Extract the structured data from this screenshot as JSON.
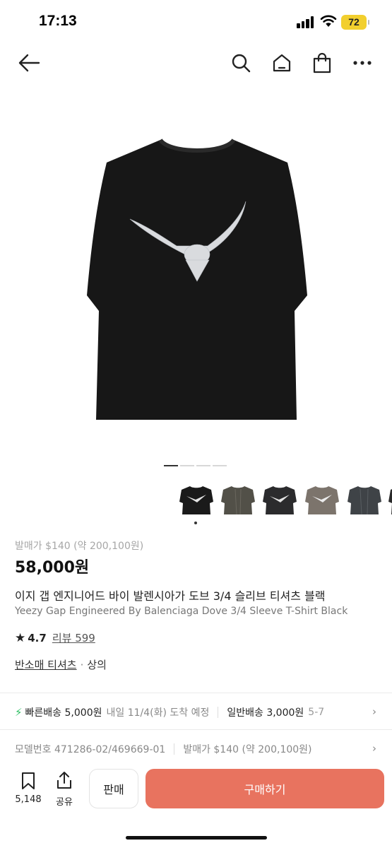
{
  "status_bar": {
    "time": "17:13",
    "battery": "72"
  },
  "nav": {
    "icons": [
      "back-arrow-icon",
      "search-icon",
      "home-icon",
      "shopping-bag-icon",
      "more-icon"
    ]
  },
  "gallery": {
    "thumbnail_count": 6,
    "active_index": 0
  },
  "product": {
    "release_price": "발매가 $140 (약 200,100원)",
    "price": "58,000원",
    "name_ko": "이지 갭 엔지니어드 바이 발렌시아가 도브 3/4 슬리브 티셔츠 블랙",
    "name_en": "Yeezy Gap Engineered By Balenciaga Dove 3/4 Sleeve T-Shirt Black",
    "rating": "4.7",
    "review_label": "리뷰 599",
    "category_primary": "반소매 티셔츠",
    "category_separator": "·",
    "category_secondary": "상의"
  },
  "delivery": {
    "fast_label": "빠른배송 5,000원",
    "fast_eta": "내일 11/4(화) 도착 예정",
    "normal_label": "일반배송 3,000원",
    "normal_eta": "5-7"
  },
  "model_row": {
    "model_number": "모델번호 471286-02/469669-01",
    "release_price": "발매가 $140 (약 200,100원)"
  },
  "bottom_bar": {
    "bookmark_count": "5,148",
    "share_label": "공유",
    "sell_label": "판매",
    "buy_label": "구매하기"
  },
  "colors": {
    "buy_button": "#e8735f",
    "fast_delivery_icon": "#2dbf63",
    "battery": "#f2cf2e"
  }
}
